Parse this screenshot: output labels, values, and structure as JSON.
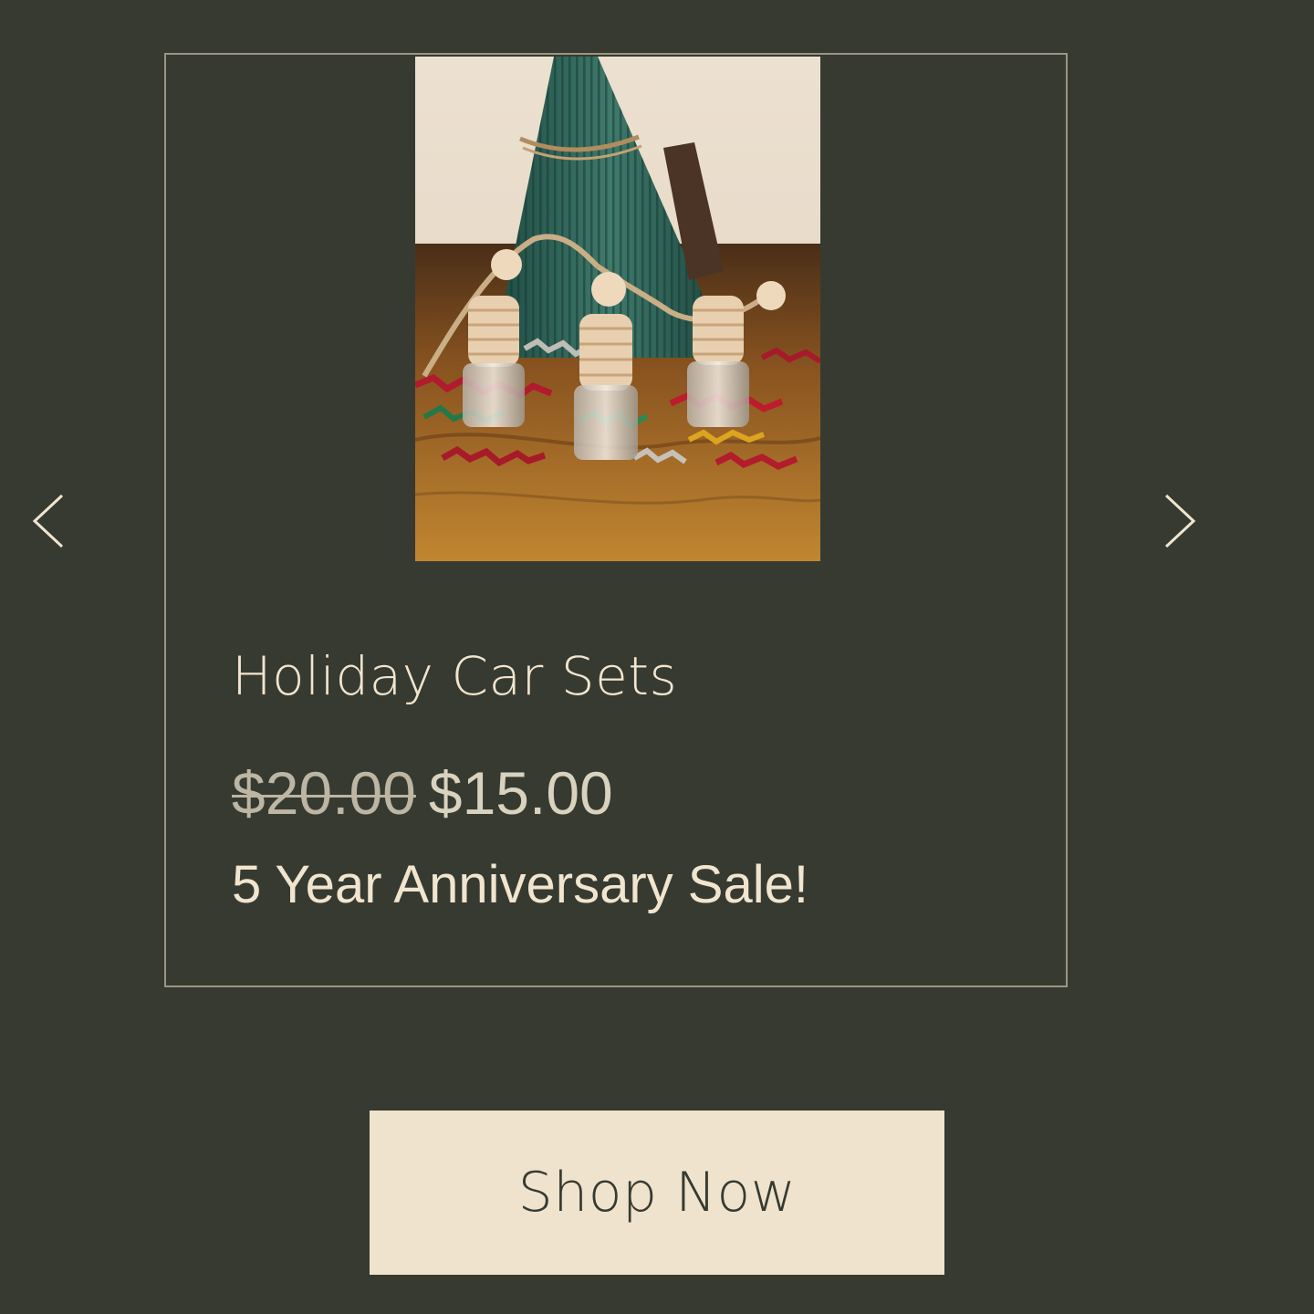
{
  "carousel": {
    "prev_icon": "chevron-left-icon",
    "next_icon": "chevron-right-icon"
  },
  "product": {
    "title": "Holiday Car Sets",
    "price_original": "$20.00",
    "price_sale": "$15.00",
    "ribbon": "5 Year Anniversary Sale!",
    "image_alt": "Holiday car freshener bottles"
  },
  "cta": {
    "label": "Shop Now"
  },
  "colors": {
    "background": "#373a31",
    "text": "#f1e5cf",
    "border": "#9c9581",
    "button_bg": "#efe3cd"
  }
}
